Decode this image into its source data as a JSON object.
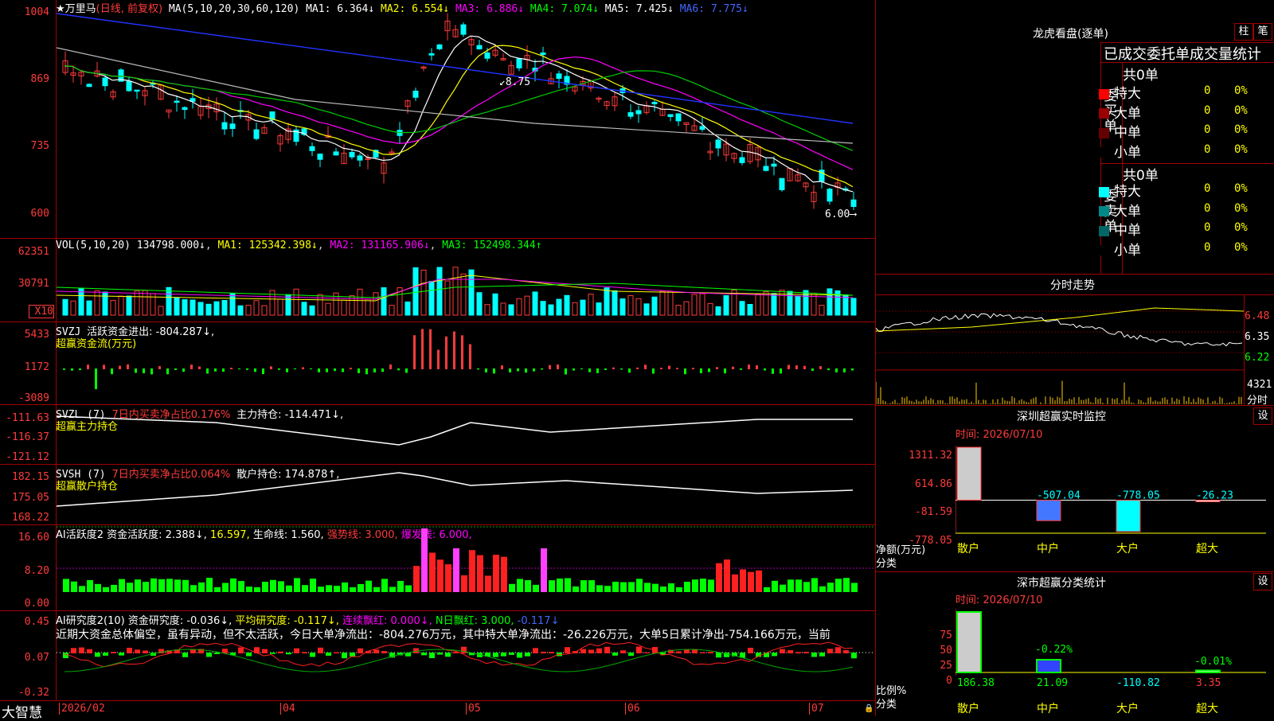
{
  "header": {
    "title": "★万里马",
    "period": "(日线, 前复权)",
    "ma_label": "MA(5,10,20,30,60,120)",
    "ma1": "MA1: 6.364↓",
    "ma2": "MA2: 6.554↓",
    "ma3": "MA3: 6.886↓",
    "ma4": "MA4: 7.074↓",
    "ma5": "MA5: 7.425↓",
    "ma6": "MA6: 7.775↓"
  },
  "price_axis": [
    "1004",
    "869",
    "735",
    "600"
  ],
  "price_annotations": {
    "high": "8.75",
    "low": "6.00"
  },
  "vol": {
    "label": "VOL(5,10,20)",
    "value": "134798.000↓",
    "ma1": "MA1: 125342.398↓",
    "ma2": "MA2: 131165.906↓",
    "ma3": "MA3: 152498.344↑",
    "axis": [
      "62351",
      "30791",
      "X10"
    ]
  },
  "svzj": {
    "label": "SVZJ",
    "desc": "活跃资金进出: -804.287↓,",
    "sub": "超赢资金流(万元)",
    "axis": [
      "5433",
      "1172",
      "-3089"
    ]
  },
  "svzl": {
    "label": "SVZL (7)",
    "desc_red": "7日内买卖净占比0.176%",
    "desc": "主力持仓: -114.471↓,",
    "sub": "超赢主力持仓",
    "axis": [
      "-111.63",
      "-116.37",
      "-121.12"
    ]
  },
  "svsh": {
    "label": "SVSH (7)",
    "desc_red": "7日内买卖净占比0.064%",
    "desc": "散户持仓: 174.878↑,",
    "sub": "超赢散户持仓",
    "axis": [
      "182.15",
      "175.05",
      "168.22"
    ]
  },
  "ai1": {
    "label": "AI活跃度2",
    "a": "资金活跃度: 2.388↓,",
    "b": "16.597,",
    "c": "生命线: 1.560,",
    "d": "强势线: 3.000,",
    "e": "爆发线: 6.000,",
    "axis": [
      "16.60",
      "8.20",
      "0.00"
    ]
  },
  "ai2": {
    "label": "AI研究度2(10)",
    "a": "资金研究度: -0.036↓,",
    "b": "平均研究度: -0.117↓,",
    "c": "连续飘红: 0.000↓,",
    "d": "N日飘红: 3.000,",
    "e": "-0.117↓",
    "text": "近期大资金总体偏空，虽有异动，但不太活跃，今日大单净流出：-804.276万元，其中特大单净流出：-26.226万元，大单5日累计净出-754.166万元，当前",
    "axis": [
      "0.45",
      "0.07",
      "-0.32"
    ]
  },
  "dates": [
    "2026/02",
    "04",
    "05",
    "06",
    "07"
  ],
  "brand": "大智慧",
  "right": {
    "lhb_title": "龙虎看盘(逐单)",
    "btn_bar": "柱",
    "btn_pen": "笔",
    "tabs": "已成交委托单成交量统计",
    "buy_label": "委买单",
    "sell_label": "委卖单",
    "buy_total": "共0单",
    "sell_total": "共0单",
    "buy_rows": [
      {
        "name": "特大",
        "v": "0",
        "p": "0%",
        "color": "#ff0000"
      },
      {
        "name": "大单",
        "v": "0",
        "p": "0%",
        "color": "#990000"
      },
      {
        "name": "中单",
        "v": "0",
        "p": "0%",
        "color": "#660000"
      },
      {
        "name": "小单",
        "v": "0",
        "p": "0%",
        "color": "#000000"
      }
    ],
    "sell_rows": [
      {
        "name": "特大",
        "v": "0",
        "p": "0%",
        "color": "#00ffff"
      },
      {
        "name": "大单",
        "v": "0",
        "p": "0%",
        "color": "#008888"
      },
      {
        "name": "中单",
        "v": "0",
        "p": "0%",
        "color": "#006666"
      },
      {
        "name": "小单",
        "v": "0",
        "p": "0%",
        "color": "#000000"
      }
    ],
    "intraday_title": "分时走势",
    "intraday_axis": [
      "6.48",
      "6.35",
      "6.22"
    ],
    "intraday_vol": "4321",
    "intraday_tag": "分时",
    "monitor_title": "深圳超赢实时监控",
    "monitor_btn": "设",
    "monitor_time": "时间: 2026/07/10",
    "monitor_axis": [
      "1311.32",
      "614.86",
      "-81.59",
      "-778.05"
    ],
    "monitor_ylabel": "净额(万元)",
    "monitor_xlabel": "分类",
    "monitor_cats": [
      "散户",
      "中户",
      "大户",
      "超大"
    ],
    "monitor_vals": [
      "1311.32",
      "-507.04",
      "-778.05",
      "-26.23"
    ],
    "class_title": "深市超赢分类统计",
    "class_btn": "设",
    "class_time": "时间: 2026/07/10",
    "class_axis": [
      "75",
      "50",
      "25",
      "0"
    ],
    "class_ylabel": "比例%",
    "class_xlabel": "分类",
    "class_cats": [
      "散户",
      "中户",
      "大户",
      "超大"
    ],
    "class_bar_labels": [
      "-0.22%",
      "-0.01%"
    ],
    "class_vals": [
      "186.38",
      "21.09",
      "-110.82",
      "3.35"
    ]
  },
  "chart_data": [
    {
      "type": "bar",
      "title": "深圳超赢实时监控",
      "ylabel": "净额(万元)",
      "xlabel": "分类",
      "categories": [
        "散户",
        "中户",
        "大户",
        "超大"
      ],
      "values": [
        1311.32,
        -507.04,
        -778.05,
        -26.23
      ],
      "ylim": [
        -778.05,
        1311.32
      ]
    },
    {
      "type": "bar",
      "title": "深市超赢分类统计",
      "ylabel": "比例%",
      "xlabel": "分类",
      "categories": [
        "散户",
        "中户",
        "大户",
        "超大"
      ],
      "values": [
        186.38,
        21.09,
        -110.82,
        3.35
      ],
      "ylim": [
        0,
        75
      ]
    }
  ]
}
